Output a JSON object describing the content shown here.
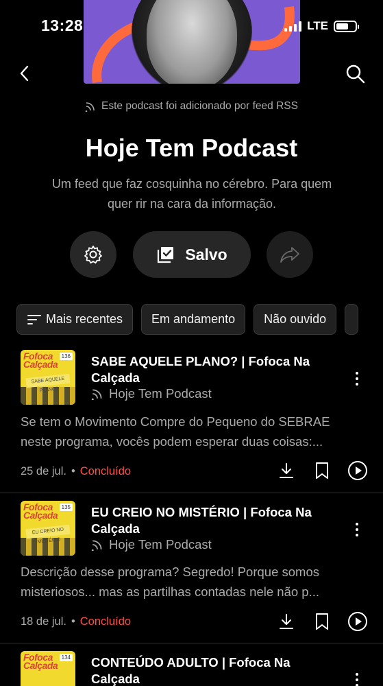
{
  "status_bar": {
    "time": "13:28",
    "network": "LTE"
  },
  "header": {
    "rss_note": "Este podcast foi adicionado por feed RSS"
  },
  "podcast": {
    "title": "Hoje Tem Podcast",
    "description": "Um feed que faz cosquinha no cérebro. Para quem quer rir na cara da informação."
  },
  "actions": {
    "saved_label": "Salvo"
  },
  "filters": [
    "Mais recentes",
    "Em andamento",
    "Não ouvido"
  ],
  "episodes": [
    {
      "title": "SABE AQUELE PLANO? | Fofoca Na Calçada",
      "channel": "Hoje Tem Podcast",
      "description": "Se tem o Movimento Compre do Pequeno do SEBRAE neste programa, vocês podem esperar duas coisas:...",
      "date": "25 de jul.",
      "status": "Concluído",
      "thumb_title": "Fofoca Calçada",
      "thumb_badge": "136",
      "thumb_band": "SABE AQUELE PLANO?"
    },
    {
      "title": "EU CREIO NO MISTÉRIO | Fofoca Na Calçada",
      "channel": "Hoje Tem Podcast",
      "description": "Descrição desse programa? Segredo! Porque somos misteriosos... mas as partilhas contadas nele não p...",
      "date": "18 de jul.",
      "status": "Concluído",
      "thumb_title": "Fofoca Calçada",
      "thumb_badge": "135",
      "thumb_band": "EU CREIO NO MISTÉRIO"
    },
    {
      "title": "CONTEÚDO ADULTO | Fofoca Na Calçada",
      "channel": "",
      "description": "",
      "date": "",
      "status": "",
      "thumb_title": "Fofoca Calçada",
      "thumb_badge": "134",
      "thumb_band": ""
    }
  ],
  "colors": {
    "background": "#000000",
    "accent_status": "#ff4e45",
    "art_purple": "#7b5ad1"
  }
}
